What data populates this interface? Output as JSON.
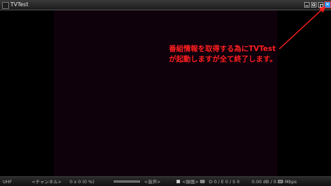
{
  "window": {
    "title": "TVTest",
    "icons": {
      "app": "tv-app-icon",
      "minimize": "minimize-icon",
      "maximize": "maximize-icon",
      "restore": "restore-icon",
      "close": "close-icon"
    },
    "close_glyph": "✕"
  },
  "annotation": {
    "line1": "番組情報を取得する為にTVTest",
    "line2": "が起動しますが全て終了します。",
    "color": "#ff1f1f"
  },
  "statusbar": {
    "channel_type": "UHF",
    "channel": "<チャンネル>",
    "position": "0 x 0 (0 %)",
    "audio": "<音声>",
    "recording": "<録画>",
    "drop": "D 0 / E 0 / S 0",
    "signal": "0.00 dB / 0.00 Mbps",
    "icons": {
      "recording": "record-icon",
      "capture": "camera-icon",
      "channel_info": "program-guide-icon"
    }
  },
  "colors": {
    "video_letterbox": "#0f010c",
    "close_button": "#1e90ff"
  }
}
